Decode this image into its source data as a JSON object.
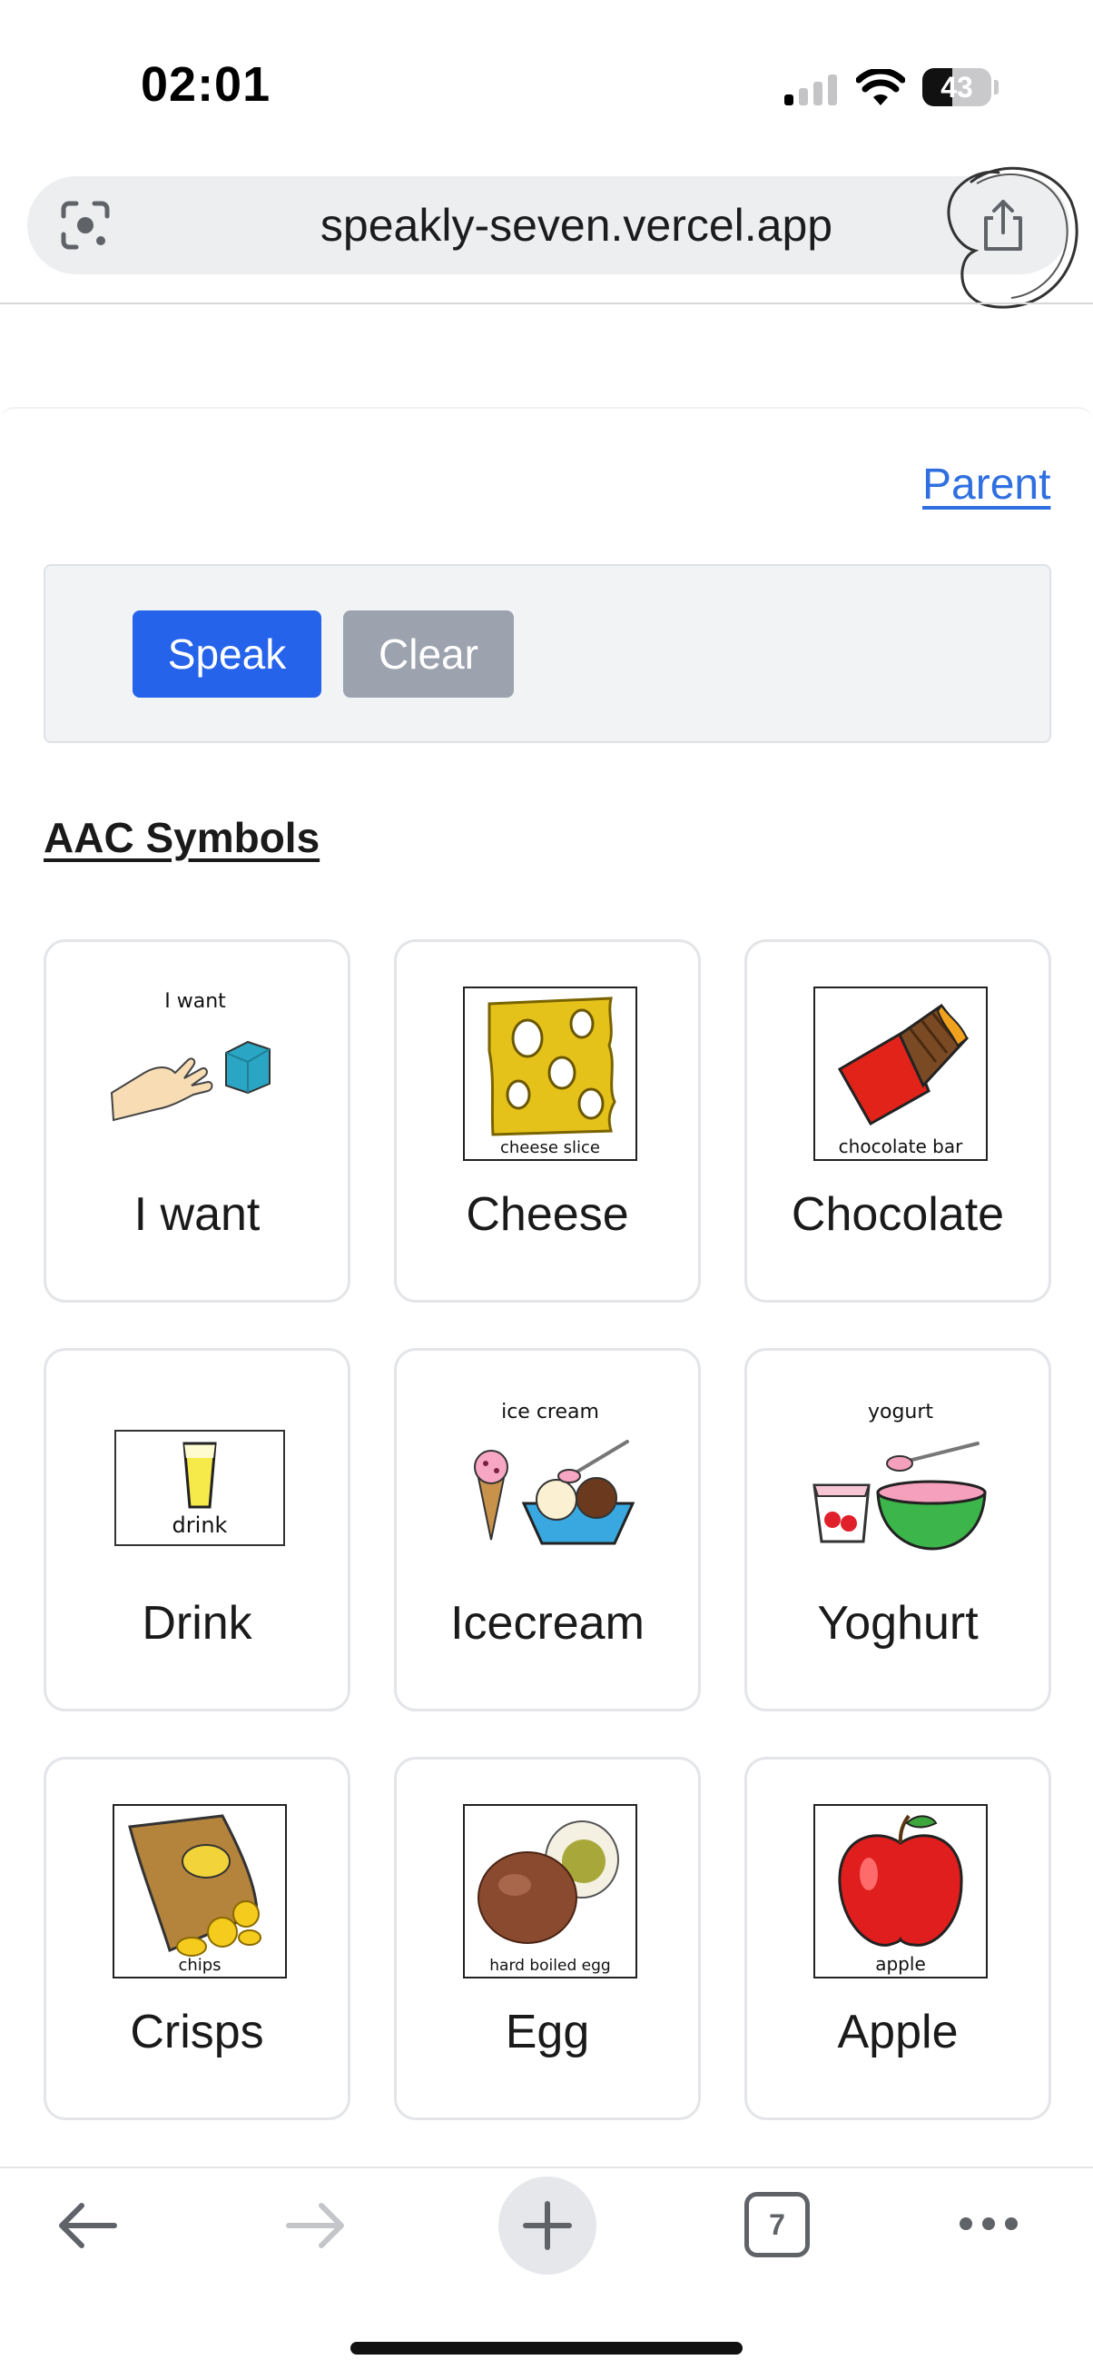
{
  "status_bar": {
    "time": "02:01",
    "battery_level": "43",
    "icons": [
      "cellular-signal-icon",
      "wifi-icon",
      "battery-icon"
    ]
  },
  "browser": {
    "url": "speakly-seven.vercel.app",
    "lens_icon": "camera-lens-icon",
    "share_icon": "share-icon",
    "tab_count": "7",
    "toolbar_icons": [
      "back-arrow-icon",
      "forward-arrow-icon",
      "plus-icon",
      "tab-switcher-icon",
      "more-icon"
    ]
  },
  "page": {
    "parent_link": "Parent",
    "speak_label": "Speak",
    "clear_label": "Clear",
    "section_title": "AAC Symbols",
    "accent_color": "#2563eb",
    "link_color": "#2f6fe0",
    "symbols": [
      {
        "label": "I want",
        "caption": "I want"
      },
      {
        "label": "Cheese",
        "caption": "cheese slice"
      },
      {
        "label": "Chocolate",
        "caption": "chocolate bar"
      },
      {
        "label": "Drink",
        "caption": "drink"
      },
      {
        "label": "Icecream",
        "caption": "ice cream"
      },
      {
        "label": "Yoghurt",
        "caption": "yogurt"
      },
      {
        "label": "Crisps",
        "caption": "chips"
      },
      {
        "label": "Egg",
        "caption": "hard boiled egg"
      },
      {
        "label": "Apple",
        "caption": "apple"
      }
    ]
  }
}
